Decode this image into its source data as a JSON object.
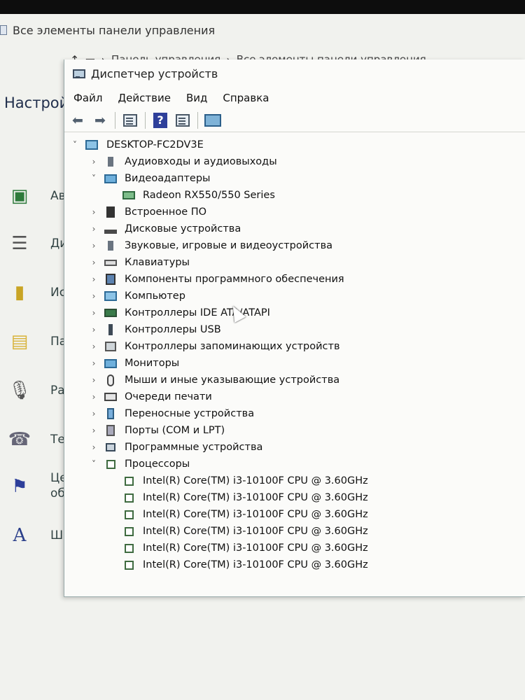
{
  "control_panel": {
    "title": "Все элементы панели управления",
    "breadcrumb": [
      "Панель управления",
      "Все элементы панели управления"
    ],
    "heading": "Настрой",
    "left_items": [
      {
        "label": "Ав",
        "icon": "action-center-icon"
      },
      {
        "label": "Ди",
        "icon": "disk-stack-icon"
      },
      {
        "label": "Ис",
        "icon": "file-history-icon"
      },
      {
        "label": "Па",
        "icon": "folder-options-icon"
      },
      {
        "label": "Ра",
        "icon": "microphone-icon"
      },
      {
        "label": "Те",
        "icon": "phone-modem-icon"
      },
      {
        "label": "Це",
        "label2": "об",
        "icon": "flag-icon"
      },
      {
        "label": "Ш",
        "icon": "fonts-icon"
      }
    ]
  },
  "device_manager": {
    "title": "Диспетчер устройств",
    "menu": [
      "Файл",
      "Действие",
      "Вид",
      "Справка"
    ],
    "computer": "DESKTOP-FC2DV3E",
    "categories": [
      {
        "label": "Аудиовходы и аудиовыходы",
        "icon": "speaker",
        "expanded": false
      },
      {
        "label": "Видеоадаптеры",
        "icon": "monitor",
        "expanded": true,
        "children": [
          "Radeon RX550/550 Series"
        ]
      },
      {
        "label": "Встроенное ПО",
        "icon": "firmware",
        "expanded": false
      },
      {
        "label": "Дисковые устройства",
        "icon": "disk",
        "expanded": false
      },
      {
        "label": "Звуковые, игровые и видеоустройства",
        "icon": "speaker",
        "expanded": false
      },
      {
        "label": "Клавиатуры",
        "icon": "keyboard",
        "expanded": false
      },
      {
        "label": "Компоненты программного обеспечения",
        "icon": "software",
        "expanded": false
      },
      {
        "label": "Компьютер",
        "icon": "pc",
        "expanded": false
      },
      {
        "label": "Контроллеры IDE ATA/ATAPI",
        "icon": "ide",
        "expanded": false
      },
      {
        "label": "Контроллеры USB",
        "icon": "usb",
        "expanded": false
      },
      {
        "label": "Контроллеры запоминающих устройств",
        "icon": "storage",
        "expanded": false
      },
      {
        "label": "Мониторы",
        "icon": "monitor",
        "expanded": false
      },
      {
        "label": "Мыши и иные указывающие устройства",
        "icon": "mouse",
        "expanded": false
      },
      {
        "label": "Очереди печати",
        "icon": "printer",
        "expanded": false
      },
      {
        "label": "Переносные устройства",
        "icon": "portable",
        "expanded": false
      },
      {
        "label": "Порты (COM и LPT)",
        "icon": "port",
        "expanded": false
      },
      {
        "label": "Программные устройства",
        "icon": "program",
        "expanded": false
      },
      {
        "label": "Процессоры",
        "icon": "chip",
        "expanded": true,
        "children": [
          "Intel(R) Core(TM) i3-10100F CPU @ 3.60GHz",
          "Intel(R) Core(TM) i3-10100F CPU @ 3.60GHz",
          "Intel(R) Core(TM) i3-10100F CPU @ 3.60GHz",
          "Intel(R) Core(TM) i3-10100F CPU @ 3.60GHz",
          "Intel(R) Core(TM) i3-10100F CPU @ 3.60GHz",
          "Intel(R) Core(TM) i3-10100F CPU @ 3.60GHz"
        ]
      }
    ]
  }
}
